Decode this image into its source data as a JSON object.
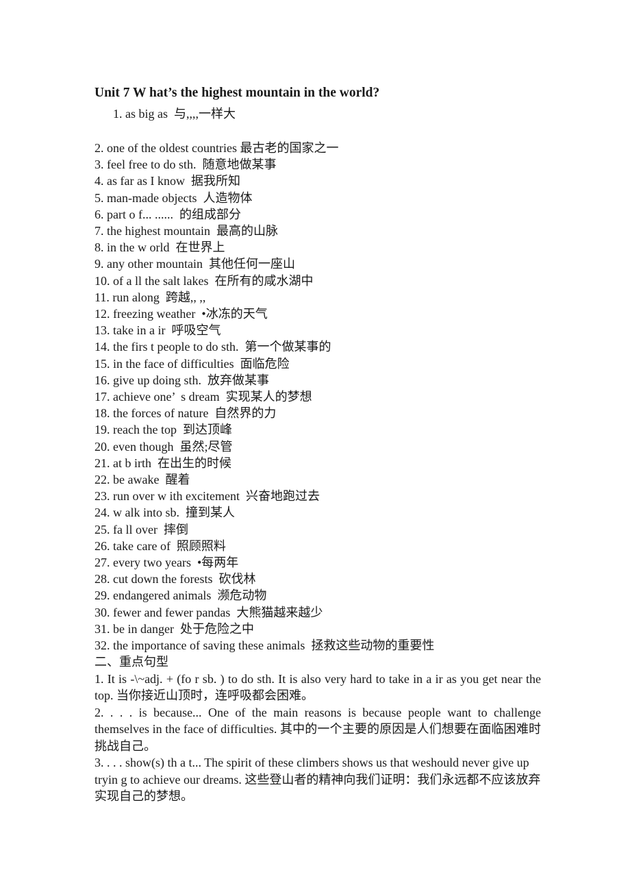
{
  "document": {
    "title": "Unit 7 W hat’s the highest mountain in the world?",
    "first_entry": "  1. as big as  与,,,,一样大",
    "vocabulary": [
      "2. one of the oldest countries 最古老的国家之一",
      "3. feel free to do sth.  随意地做某事",
      "4. as far as I know  据我所知",
      "5. man-made objects  人造物体",
      "6. part o f... ......  的组成部分",
      "7. the highest mountain  最高的山脉",
      "8. in the w orld  在世界上",
      "9. any other mountain  其他任何一座山",
      "10. of a ll the salt lakes  在所有的咸水湖中",
      "11. run along  跨越,, ,,",
      "12. freezing weather  •冰冻的天气",
      "13. take in a ir  呼吸空气",
      "14. the firs t people to do sth.  第一个做某事的",
      "15. in the face of difficulties  面临危险",
      "16. give up doing sth.  放弃做某事",
      "17. achieve one’  s dream  实现某人的梦想",
      "18. the forces of nature  自然界的力",
      "19. reach the top  到达顶峰",
      "20. even though  虽然;尽管",
      "21. at b irth  在出生的时候",
      "22. be awake  醒着",
      "23. run over w ith excitement  兴奋地跑过去",
      "24. w alk into sb.  撞到某人",
      "25. fa ll over  摔倒",
      "26. take care of  照顾照料",
      "27. every two years  •每两年",
      "28. cut down the forests  砍伐林",
      "29. endangered animals  濒危动物",
      "30. fewer and fewer pandas  大熊猫越来越少",
      "31. be in danger  处于危险之中",
      "32. the importance of saving these animals  拯救这些动物的重要性"
    ],
    "section_heading": "二、重点句型",
    "patterns": [
      "1. It is -\\~adj. + (fo r sb. ) to do sth. It is also very hard to take in a ir as you get near the top.  当你接近山顶时，连呼吸都会困难。",
      "2. . . . is because...    One of the main reasons is because people want to challenge themselves in the face of difficulties.  其中的一个主要的原因是人们想要在面临困难时挑战自己。",
      "3. . . . show(s) th a t...    The spirit of these climbers shows us that weshould never give up tryin g to achieve our dreams.    这些登山者的精神向我们证明：我们永远都不应该放弃实现自己的梦想。"
    ]
  }
}
